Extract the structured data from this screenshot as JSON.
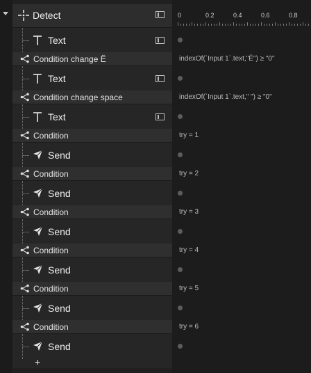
{
  "tree": {
    "root": {
      "label": "Detect",
      "icon": "move-crosshair-icon"
    },
    "rows": [
      {
        "kind": "child",
        "label": "Text",
        "icon": "text-icon"
      },
      {
        "kind": "cond",
        "label": "Condition change Ë",
        "icon": "branch-icon"
      },
      {
        "kind": "child",
        "label": "Text",
        "icon": "text-icon"
      },
      {
        "kind": "cond",
        "label": "Condition change space",
        "icon": "branch-icon"
      },
      {
        "kind": "child",
        "label": "Text",
        "icon": "text-icon"
      },
      {
        "kind": "cond",
        "label": "Condition",
        "icon": "branch-icon"
      },
      {
        "kind": "child",
        "label": "Send",
        "icon": "send-icon"
      },
      {
        "kind": "cond",
        "label": "Condition",
        "icon": "branch-icon"
      },
      {
        "kind": "child",
        "label": "Send",
        "icon": "send-icon"
      },
      {
        "kind": "cond",
        "label": "Condition",
        "icon": "branch-icon"
      },
      {
        "kind": "child",
        "label": "Send",
        "icon": "send-icon"
      },
      {
        "kind": "cond",
        "label": "Condition",
        "icon": "branch-icon"
      },
      {
        "kind": "child",
        "label": "Send",
        "icon": "send-icon"
      },
      {
        "kind": "cond",
        "label": "Condition",
        "icon": "branch-icon"
      },
      {
        "kind": "child",
        "label": "Send",
        "icon": "send-icon"
      },
      {
        "kind": "cond",
        "label": "Condition",
        "icon": "branch-icon"
      },
      {
        "kind": "child",
        "label": "Send",
        "icon": "send-icon"
      }
    ],
    "add_label": "+",
    "insert_label": "+"
  },
  "timeline": {
    "ticks": [
      "0",
      "0.2",
      "0.4",
      "0.6",
      "0.8"
    ],
    "expressions": [
      "indexOf(`Input 1`.text,\"Ë\") ≥ \"0\"",
      "indexOf(`Input 1`.text,\" \") ≥ \"0\"",
      "try = 1",
      "try = 2",
      "try = 3",
      "try = 4",
      "try = 5",
      "try = 6"
    ]
  }
}
